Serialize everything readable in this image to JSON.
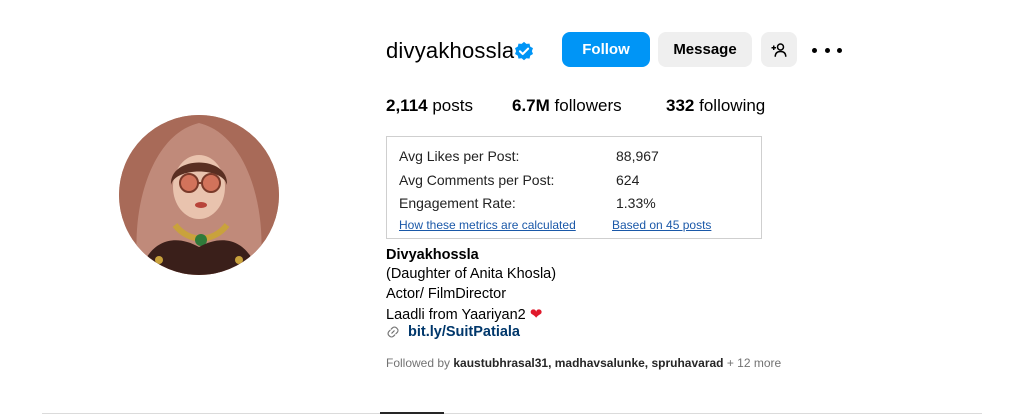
{
  "profile": {
    "username": "divyakhossla",
    "verified": true,
    "avatar_icon": "profile-photo"
  },
  "actions": {
    "follow_label": "Follow",
    "message_label": "Message",
    "add_user_icon": "add-user-icon",
    "more_icon": "more-options-icon"
  },
  "stats": {
    "posts_count": "2,114",
    "posts_label": "posts",
    "followers_count": "6.7M",
    "followers_label": "followers",
    "following_count": "332",
    "following_label": "following"
  },
  "metrics": {
    "avg_likes_label": "Avg Likes per Post:",
    "avg_likes_value": "88,967",
    "avg_comments_label": "Avg Comments per Post:",
    "avg_comments_value": "624",
    "engagement_label": "Engagement Rate:",
    "engagement_value": "1.33%",
    "how_link": "How these metrics are calculated",
    "based_on_link": "Based on 45 posts"
  },
  "bio": {
    "name": "Divyakhossla",
    "line1": "(Daughter of Anita Khosla)",
    "line2": "Actor/ FilmDirector",
    "line3": "Laadli from Yaariyan2",
    "heart": "❤",
    "link": "bit.ly/SuitPatiala"
  },
  "followed_by": {
    "prefix": "Followed by",
    "users": "kaustubhrasal31, madhavsalunke, spruhavarad",
    "more": "+ 12 more"
  },
  "colors": {
    "follow_blue": "#0095f6",
    "secondary_gray": "#efefef",
    "link_blue": "#00376b",
    "heart_red": "#e0192b",
    "verified_blue": "#0095f6"
  }
}
